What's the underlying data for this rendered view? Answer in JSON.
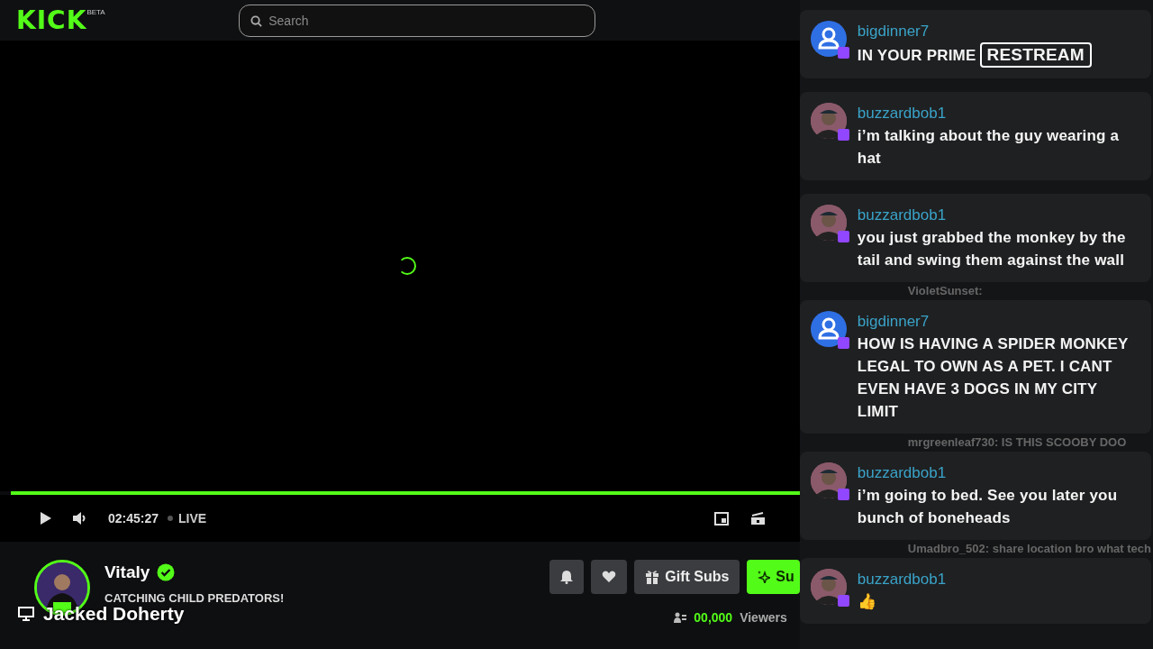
{
  "header": {
    "logo": "KICK",
    "logo_tag": "BETA",
    "search": {
      "placeholder": "Search"
    }
  },
  "player": {
    "loading": true,
    "progress": {
      "level": 1
    },
    "time": "02:45:27",
    "live": "LIVE"
  },
  "channel": {
    "name": "Vitaly",
    "verified": true,
    "title": "CATCHING CHILD PREDATORS!",
    "buttons": [
      {
        "kind": "bell"
      },
      {
        "kind": "heart"
      },
      {
        "kind": "gift",
        "label": "Gift Subs"
      },
      {
        "kind": "subscribe",
        "label": "Su"
      }
    ],
    "viewers_count": "00,000",
    "viewers_label": "Viewers"
  },
  "caption": {
    "text": "Jacked Doherty"
  },
  "chat": [
    {
      "kind": "message",
      "user": "bigdinner7",
      "avatar": {
        "kind": "placeholder"
      },
      "text": "IN YOUR PRIME",
      "badge": "RESTREAM"
    },
    {
      "kind": "message",
      "user": "buzzardbob1",
      "text": "i’m talking about the guy wearing a hat"
    },
    {
      "kind": "message",
      "user": "buzzardbob1",
      "text": "you just grabbed the monkey by the tail and swing them against the wall"
    },
    {
      "kind": "behind",
      "text": "VioletSunset:"
    },
    {
      "kind": "message",
      "user": "bigdinner7",
      "avatar": {
        "kind": "placeholder"
      },
      "text": "HOW IS HAVING A SPIDER MONKEY LEGAL TO OWN AS A PET. I CANT EVEN HAVE 3 DOGS IN MY CITY LIMIT"
    },
    {
      "kind": "behind",
      "text": "mrgreenleaf730: IS THIS SCOOBY DOO"
    },
    {
      "kind": "message",
      "user": "buzzardbob1",
      "text": "i’m going to bed. See you later you bunch of boneheads"
    },
    {
      "kind": "behind",
      "text": "Umadbro_502: share location bro what tech"
    },
    {
      "kind": "message",
      "user": "buzzardbob1",
      "text": "👍"
    }
  ]
}
